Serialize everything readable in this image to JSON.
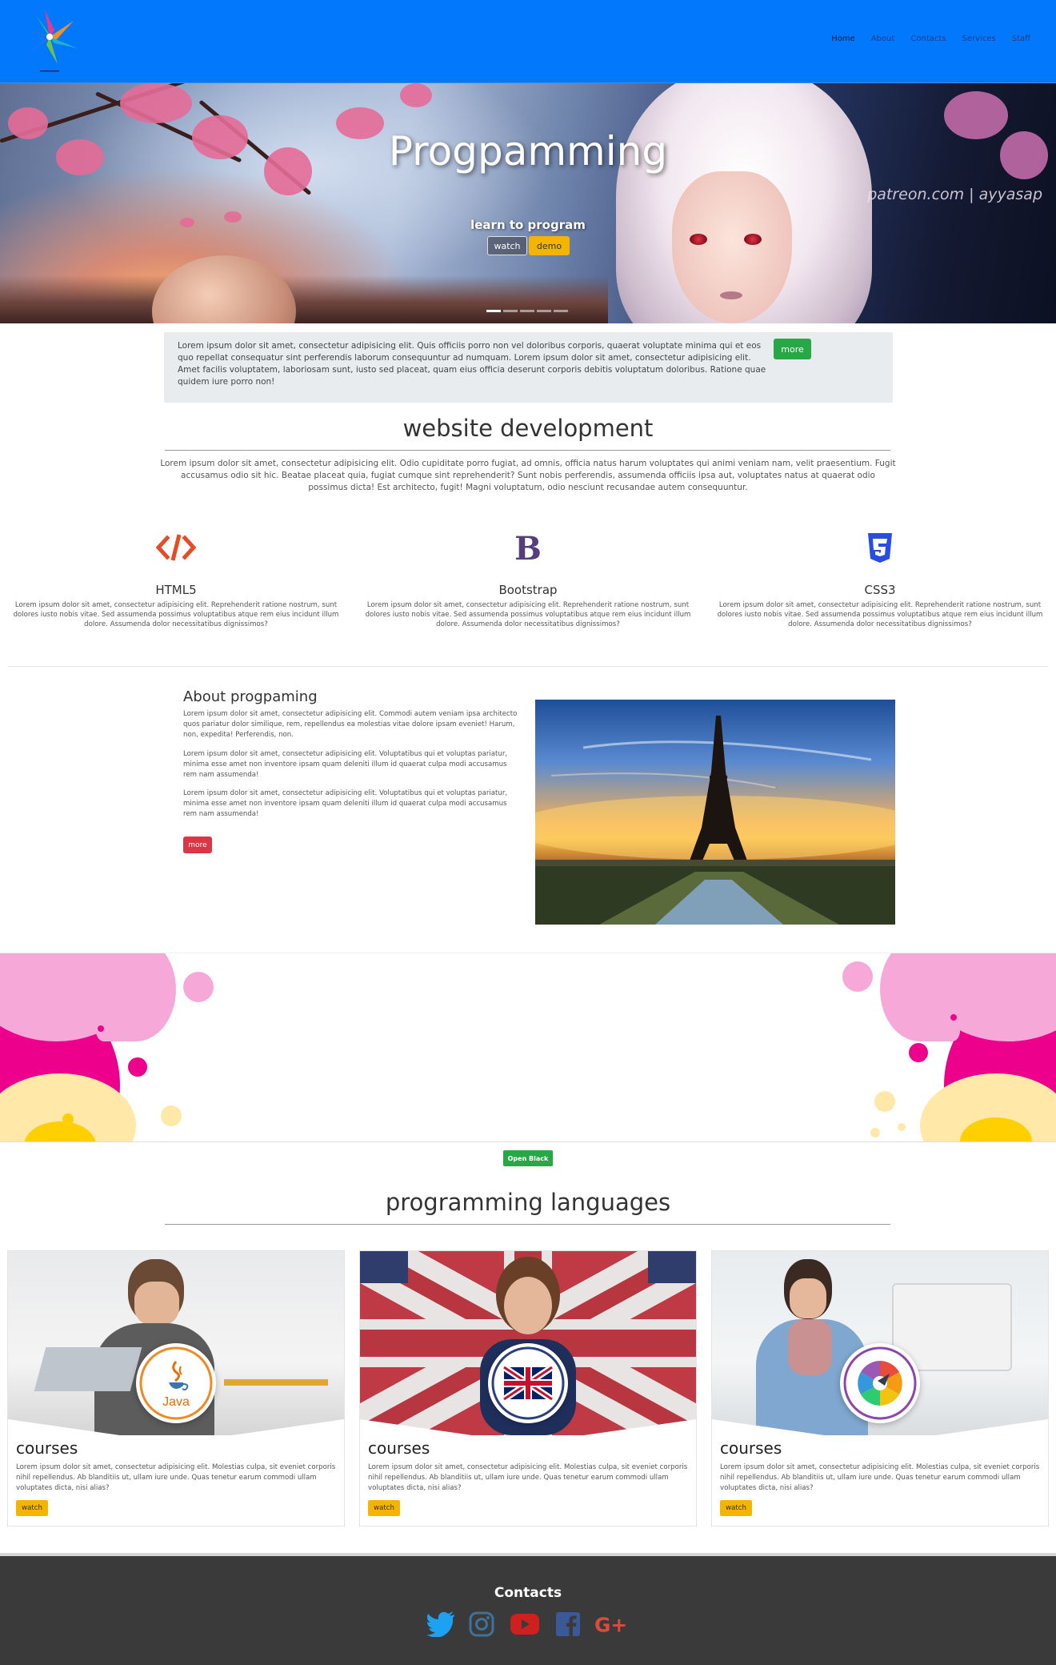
{
  "nav": {
    "links": [
      "Home",
      "About",
      "Contacts",
      "Services",
      "Staff"
    ],
    "active": "Home"
  },
  "hero": {
    "title": "Progpamming",
    "subtitle": "learn to program",
    "watch_label": "watch",
    "demo_label": "demo",
    "watermark": "patreon.com | ayyasap",
    "slide_count": 5,
    "active_slide": 1
  },
  "jumbotron": {
    "text": "Lorem ipsum dolor sit amet, consectetur adipisicing elit. Quis officiis porro non vel doloribus corporis, quaerat voluptate minima qui et eos quo repellat consequatur sint perferendis laborum consequuntur ad numquam. Lorem ipsum dolor sit amet, consectetur adipisicing elit. Amet facilis voluptatem, laboriosam sunt, iusto sed placeat, quam eius officia deserunt corporis debitis voluptatum doloribus. Ratione quae quidem iure porro non!",
    "more_label": "more"
  },
  "dev": {
    "title": "website development",
    "text": "Lorem ipsum dolor sit amet, consectetur adipisicing elit. Odio cupiditate porro fugiat, ad omnis, officia natus harum voluptates qui animi veniam nam, velit praesentium. Fugit accusamus odio sit hic. Beatae placeat quia, fugiat cumque sint reprehenderit? Sunt nobis perferendis, assumenda officiis ipsa aut, voluptates natus at quaerat odio possimus dicta! Est architecto, fugit! Magni voluptatum, odio nesciunt recusandae autem consequuntur.",
    "features": [
      {
        "title": "HTML5",
        "icon": "code-icon",
        "color": "#e44d26",
        "text": "Lorem ipsum dolor sit amet, consectetur adipisicing elit. Reprehenderit ratione nostrum, sunt dolores iusto nobis vitae. Sed assumenda possimus voluptatibus atque rem eius incidunt illum dolore. Assumenda dolor necessitatibus dignissimos?"
      },
      {
        "title": "Bootstrap",
        "icon": "bootstrap-icon",
        "color": "#563d7c",
        "text": "Lorem ipsum dolor sit amet, consectetur adipisicing elit. Reprehenderit ratione nostrum, sunt dolores iusto nobis vitae. Sed assumenda possimus voluptatibus atque rem eius incidunt illum dolore. Assumenda dolor necessitatibus dignissimos?"
      },
      {
        "title": "CSS3",
        "icon": "css3-icon",
        "color": "#264de4",
        "text": "Lorem ipsum dolor sit amet, consectetur adipisicing elit. Reprehenderit ratione nostrum, sunt dolores iusto nobis vitae. Sed assumenda possimus voluptatibus atque rem eius incidunt illum dolore. Assumenda dolor necessitatibus dignissimos?"
      }
    ]
  },
  "about": {
    "title": "About progpaming",
    "paragraphs": [
      "Lorem ipsum dolor sit amet, consectetur adipisicing elit. Commodi autem veniam ipsa architecto quos pariatur dolor similique, rem, repellendus ea molestias vitae dolore ipsam eveniet! Harum, non, expedita! Perferendis, non.",
      "Lorem ipsum dolor sit amet, consectetur adipisicing elit. Voluptatibus qui et voluptas pariatur, minima esse amet non inventore ipsam quam deleniti illum id quaerat culpa modi accusamus rem nam assumenda!",
      "Lorem ipsum dolor sit amet, consectetur adipisicing elit. Voluptatibus qui et voluptas pariatur, minima esse amet non inventore ipsam quam deleniti illum id quaerat culpa modi accusamus rem nam assumenda!"
    ],
    "more_label": "more"
  },
  "splash": {
    "open_label": "Open Black"
  },
  "languages": {
    "title": "programming languages",
    "cards": [
      {
        "title": "courses",
        "badge": "java-icon",
        "text": "Lorem ipsum dolor sit amet, consectetur adipisicing elit. Molestias culpa, sit eveniet corporis nihil repellendus. Ab blanditiis ut, ullam iure unde. Quas tenetur earum commodi ullam voluptates dicta, nisi alias?",
        "watch_label": "watch"
      },
      {
        "title": "courses",
        "badge": "uk-flag-icon",
        "text": "Lorem ipsum dolor sit amet, consectetur adipisicing elit. Molestias culpa, sit eveniet corporis nihil repellendus. Ab blanditiis ut, ullam iure unde. Quas tenetur earum commodi ullam voluptates dicta, nisi alias?",
        "watch_label": "watch"
      },
      {
        "title": "courses",
        "badge": "color-wheel-icon",
        "text": "Lorem ipsum dolor sit amet, consectetur adipisicing elit. Molestias culpa, sit eveniet corporis nihil repellendus. Ab blanditiis ut, ullam iure unde. Quas tenetur earum commodi ullam voluptates dicta, nisi alias?",
        "watch_label": "watch"
      }
    ]
  },
  "footer": {
    "title": "Contacts",
    "social": [
      {
        "name": "twitter-icon",
        "color": "#1da1f2"
      },
      {
        "name": "instagram-icon",
        "color": "#3f729b"
      },
      {
        "name": "youtube-icon",
        "color": "#cd201f"
      },
      {
        "name": "facebook-icon",
        "color": "#3b5998"
      },
      {
        "name": "google-plus-icon",
        "color": "#dd4b39"
      }
    ]
  },
  "colors": {
    "navbar": "#0279fd",
    "success": "#28a745",
    "danger": "#dc3545",
    "warning": "#f4b400",
    "footer": "#3a3a3a"
  }
}
